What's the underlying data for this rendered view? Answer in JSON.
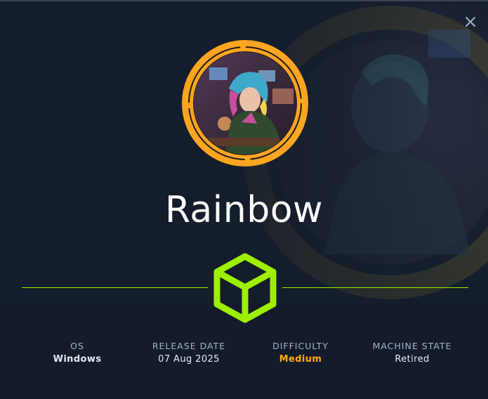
{
  "machine": {
    "name": "Rainbow"
  },
  "info": [
    {
      "label": "OS",
      "value": "Windows"
    },
    {
      "label": "RELEASE DATE",
      "value": "07 Aug 2025"
    },
    {
      "label": "DIFFICULTY",
      "value": "Medium"
    },
    {
      "label": "MACHINE STATE",
      "value": "Retired"
    }
  ],
  "colors": {
    "background": "#141d2b",
    "accent_green": "#9fef00",
    "difficulty_medium": "#ffaf00",
    "label_gray": "#a4b1cd"
  },
  "icons": {
    "close": "close-icon",
    "machine": "cube-icon"
  }
}
